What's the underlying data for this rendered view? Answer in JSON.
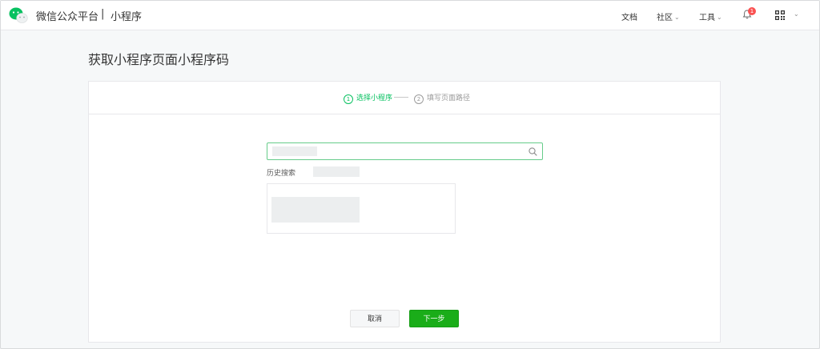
{
  "header": {
    "brand": "微信公众平台",
    "separator": "|",
    "product": "小程序",
    "nav": {
      "docs": "文档",
      "community": "社区",
      "tools": "工具"
    },
    "notification_count": "1"
  },
  "page": {
    "title": "获取小程序页面小程序码"
  },
  "steps": [
    {
      "number": "1",
      "label": "选择小程序",
      "state": "active"
    },
    {
      "number": "2",
      "label": "填写页面路径",
      "state": "inactive"
    }
  ],
  "search": {
    "history_label": "历史搜索"
  },
  "actions": {
    "cancel": "取消",
    "next": "下一步"
  },
  "colors": {
    "brand_green": "#07c160",
    "button_green": "#1aad19",
    "badge_red": "#fa5151"
  },
  "icons": [
    "wechat-logo-icon",
    "bell-icon",
    "qrcode-icon",
    "search-icon",
    "chevron-down-icon"
  ]
}
